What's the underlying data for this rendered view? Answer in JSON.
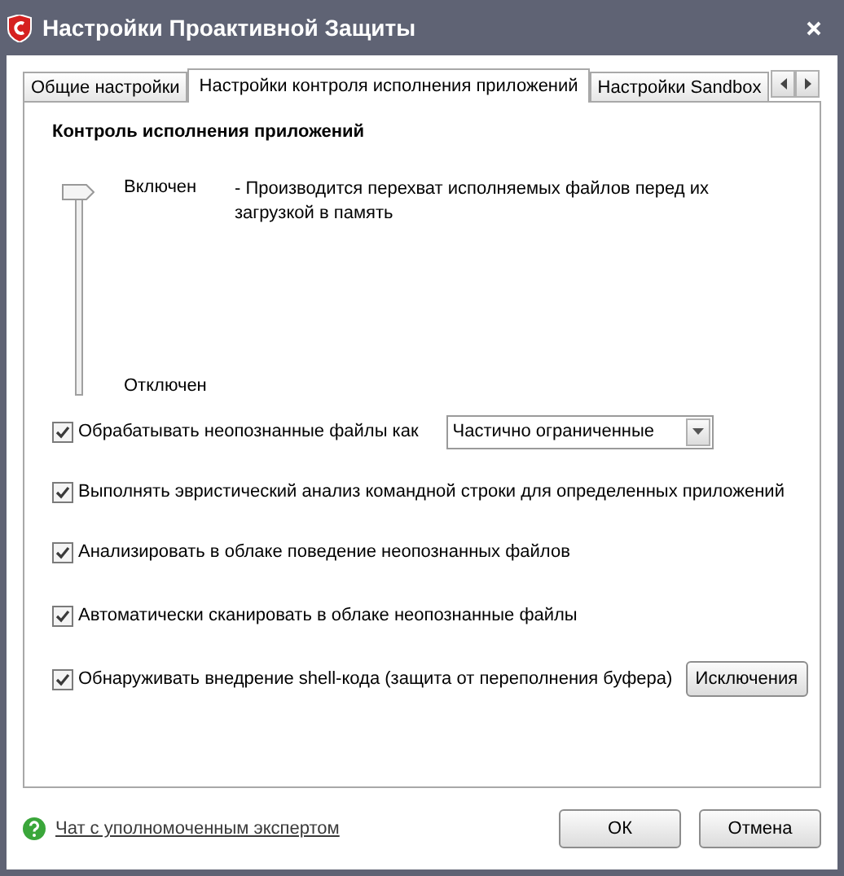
{
  "window": {
    "title": "Настройки Проактивной Защиты"
  },
  "tabs": [
    {
      "label": "Общие настройки",
      "selected": false
    },
    {
      "label": "Настройки контроля исполнения приложений",
      "selected": true
    },
    {
      "label": "Настройки Sandbox",
      "selected": false
    }
  ],
  "section_title": "Контроль исполнения приложений",
  "slider": {
    "level": 1,
    "top_label": "Включен",
    "bottom_label": "Отключен",
    "description": "- Производится перехват исполняемых файлов перед их загрузкой в память"
  },
  "options": [
    {
      "kind": "dropdown",
      "label": "Обрабатывать неопознанные файлы как",
      "checked": true,
      "value": "Частично ограниченные"
    },
    {
      "kind": "plain",
      "label": "Выполнять эвристический анализ командной строки для определенных приложений",
      "checked": true
    },
    {
      "kind": "plain",
      "label": "Анализировать в облаке поведение неопознанных файлов",
      "checked": true
    },
    {
      "kind": "plain",
      "label": "Автоматически сканировать в облаке неопознанные файлы",
      "checked": true
    },
    {
      "kind": "button",
      "label": "Обнаруживать внедрение shell-кода (защита от переполнения буфера)",
      "checked": true,
      "button": "Исключения"
    }
  ],
  "footer": {
    "help_link": "Чат с уполномоченным экспертом",
    "buttons": [
      "ОК",
      "Отмена"
    ]
  }
}
